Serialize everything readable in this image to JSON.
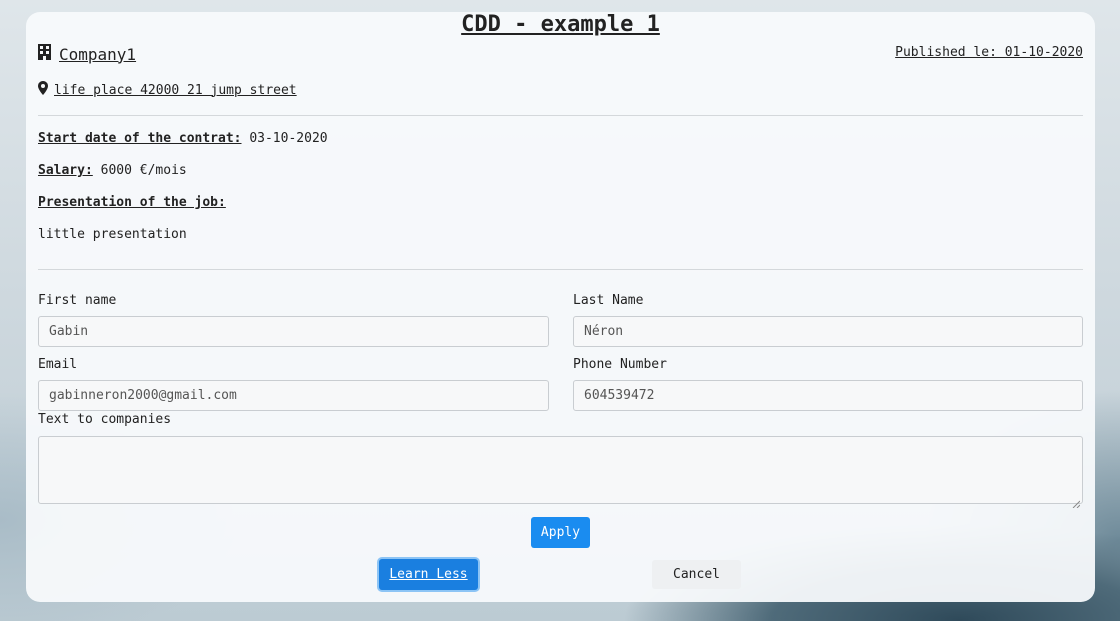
{
  "job": {
    "title": "CDD - example 1",
    "company": "Company1",
    "published": "Published le: 01-10-2020",
    "address": "life place 42000 21 jump street",
    "start_label": "Start date of the contrat:",
    "start_value": "03-10-2020",
    "salary_label": "Salary:",
    "salary_value": "6000 €/mois",
    "presentation_label": "Presentation of the job:",
    "presentation_text": "little presentation"
  },
  "form": {
    "first_name_label": "First name",
    "first_name_value": "Gabin",
    "last_name_label": "Last Name",
    "last_name_value": "Néron",
    "email_label": "Email",
    "email_value": "gabinneron2000@gmail.com",
    "phone_label": "Phone Number",
    "phone_value": "604539472",
    "text_label": "Text to companies",
    "text_value": ""
  },
  "buttons": {
    "apply": "Apply",
    "learn_less": "Learn Less",
    "cancel": "Cancel"
  },
  "icons": {
    "company": "building-icon",
    "address": "map-pin-icon"
  },
  "colors": {
    "primary": "#1a8cf0",
    "text": "#222222"
  }
}
